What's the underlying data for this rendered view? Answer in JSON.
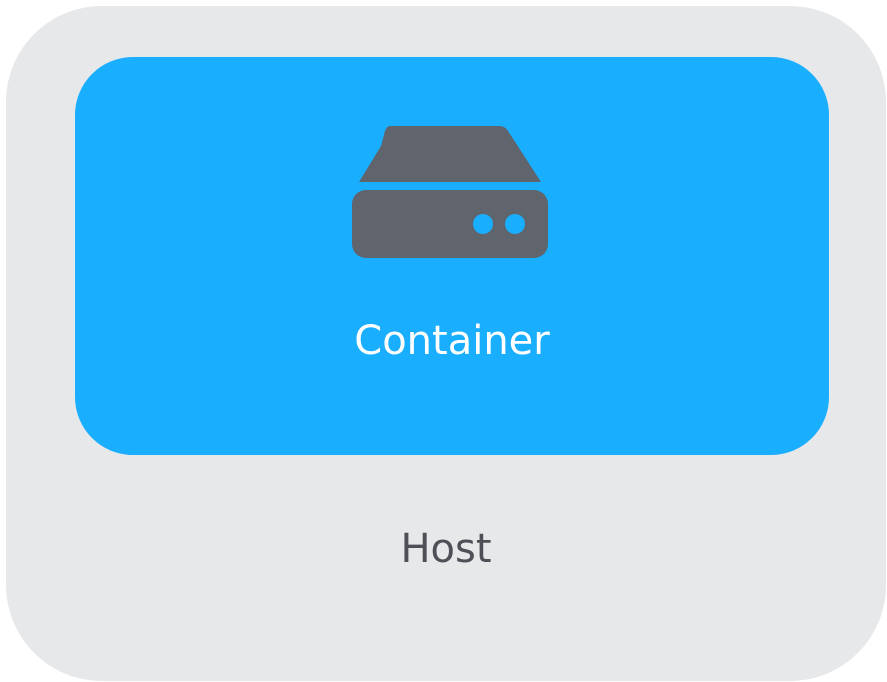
{
  "host": {
    "label": "Host",
    "background_color": "#e7e8ea"
  },
  "container": {
    "label": "Container",
    "background_color": "#1aaefe",
    "icon": "server-icon"
  }
}
